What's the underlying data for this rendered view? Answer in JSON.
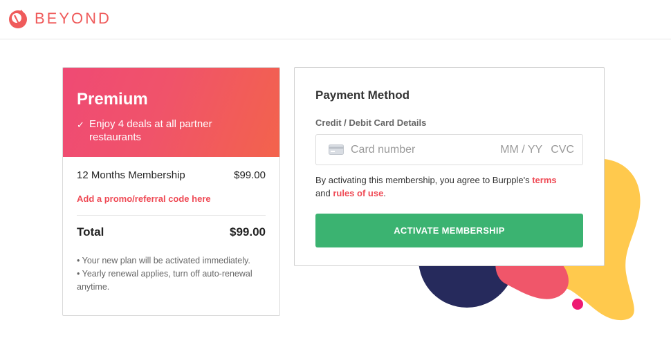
{
  "header": {
    "brand": "BEYOND"
  },
  "plan": {
    "title": "Premium",
    "benefit": "Enjoy 4 deals at all partner restaurants",
    "membership_label": "12 Months Membership",
    "membership_price": "$99.00",
    "promo_link": "Add a promo/referral code here",
    "total_label": "Total",
    "total_price": "$99.00",
    "notes": [
      "• Your new plan will be activated immediately.",
      "• Yearly renewal applies, turn off auto-renewal anytime."
    ]
  },
  "payment": {
    "title": "Payment Method",
    "card_label": "Credit / Debit Card Details",
    "card_number_placeholder": "Card number",
    "card_exp_placeholder": "MM / YY",
    "card_cvc_placeholder": "CVC",
    "agree_prefix": "By activating this membership, you agree to Burpple's",
    "terms_link": "terms",
    "agree_and": "and",
    "rules_link": "rules of use",
    "agree_suffix": ".",
    "activate_button": "ACTIVATE MEMBERSHIP"
  },
  "colors": {
    "brand": "#ef5b5b",
    "gradient_start": "#ef4a74",
    "gradient_end": "#f3634c",
    "link": "#ef4a55",
    "button": "#3bb371",
    "blob_navy": "#262a5c",
    "blob_yellow": "#ffc94d",
    "blob_coral": "#f0566a",
    "dot_pink": "#ee1a72"
  }
}
